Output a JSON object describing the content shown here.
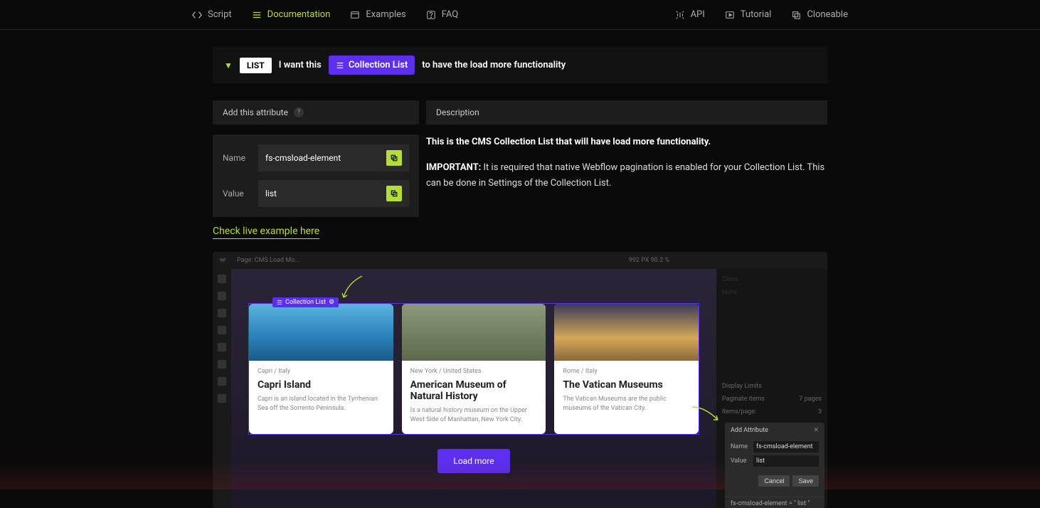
{
  "nav": {
    "script": "Script",
    "documentation": "Documentation",
    "examples": "Examples",
    "faq": "FAQ",
    "api": "API",
    "tutorial": "Tutorial",
    "cloneable": "Cloneable"
  },
  "rule": {
    "tag": "LIST",
    "prefix": "I want this",
    "collection": "Collection List",
    "suffix": "to have the load more functionality"
  },
  "panel": {
    "addAttrLabel": "Add this attribute",
    "nameLabel": "Name",
    "valueLabel": "Value",
    "nameValue": "fs-cmsload-element",
    "valueValue": "list",
    "descLabel": "Description",
    "descText1": "This is the CMS Collection List that will have load more functionality.",
    "descImportant": "IMPORTANT:",
    "descText2": " It is required that native Webflow pagination is enabled for your Collection List. This can be done in Settings of the Collection List.",
    "exampleLink": "Check live example here"
  },
  "example": {
    "pageLabel": "Page: CMS Load Mo...",
    "viewportInfo": "992 PX   90.2 %",
    "collectionTag": "Collection List",
    "cards": [
      {
        "loc": "Capri  /  Italy",
        "title": "Capri Island",
        "desc": "Capri is an island located in the Tyrrhenian Sea off the Sorrento Peninsula."
      },
      {
        "loc": "New York  /  United States",
        "title": "American Museum of Natural History",
        "desc": "Is a natural history museum on the Upper West Side of Manhattan, New York City."
      },
      {
        "loc": "Rome  /  Italy",
        "title": "The Vatican Museums",
        "desc": "The Vatican Museums are the public museums of the Vatican City."
      }
    ],
    "loadMore": "Load more",
    "rightPanel": {
      "displayLimits": "Display Limits",
      "paginate": "Paginate items",
      "pages": "7 pages",
      "itemsPerPage": "Items/page:",
      "itemsVal": "3"
    },
    "modal": {
      "title": "Add Attribute",
      "nameLabel": "Name",
      "nameVal": "fs-cmsload-element",
      "valueLabel": "Value",
      "valueVal": "list",
      "cancel": "Cancel",
      "save": "Save",
      "attrString": "fs-cmsload-element = \" list \""
    }
  }
}
